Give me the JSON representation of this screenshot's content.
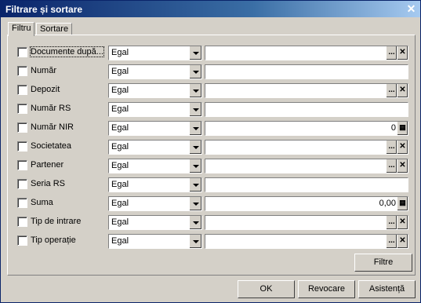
{
  "window": {
    "title": "Filtrare și sortare",
    "close_glyph": "✕"
  },
  "tabs": [
    {
      "label": "Filtru",
      "active": true
    },
    {
      "label": "Sortare",
      "active": false
    }
  ],
  "rows": [
    {
      "label": "Documente după...",
      "operator": "Egal",
      "value": "",
      "buttons": [
        "...",
        "✕"
      ]
    },
    {
      "label": "Număr",
      "operator": "Egal",
      "value": "",
      "buttons": []
    },
    {
      "label": "Depozit",
      "operator": "Egal",
      "value": "",
      "buttons": [
        "...",
        "✕"
      ]
    },
    {
      "label": "Număr RS",
      "operator": "Egal",
      "value": "",
      "buttons": []
    },
    {
      "label": "Număr NIR",
      "operator": "Egal",
      "value": "0",
      "buttons": [
        "calculator"
      ]
    },
    {
      "label": "Societatea",
      "operator": "Egal",
      "value": "",
      "buttons": [
        "...",
        "✕"
      ]
    },
    {
      "label": "Partener",
      "operator": "Egal",
      "value": "",
      "buttons": [
        "...",
        "✕"
      ]
    },
    {
      "label": "Seria RS",
      "operator": "Egal",
      "value": "",
      "buttons": []
    },
    {
      "label": "Suma",
      "operator": "Egal",
      "value": "0,00",
      "buttons": [
        "calculator"
      ]
    },
    {
      "label": "Tip de intrare",
      "operator": "Egal",
      "value": "",
      "buttons": [
        "...",
        "✕"
      ]
    },
    {
      "label": "Tip operație",
      "operator": "Egal",
      "value": "",
      "buttons": [
        "...",
        "✕"
      ]
    }
  ],
  "filter_button": "Filtre",
  "footer": {
    "ok": "OK",
    "cancel": "Revocare",
    "help": "Asistență"
  },
  "glyphs": {
    "ellipsis": "...",
    "clear": "✕",
    "calculator": "▦"
  }
}
